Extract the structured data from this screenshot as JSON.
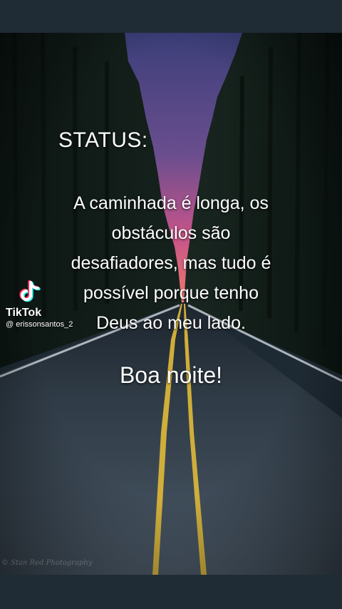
{
  "status": {
    "heading": "STATUS:"
  },
  "quote": {
    "lines": [
      "A caminhada é longa, os",
      "obstáculos são",
      "desafiadores, mas tudo é",
      "possível porque tenho",
      "Deus ao meu lado."
    ]
  },
  "greeting": "Boa noite!",
  "tiktok": {
    "brand": "TikTok",
    "handle": "@ erissonsantos_2",
    "icon": "tiktok-note-icon"
  },
  "photo_credit": "© Stan Red Photography",
  "colors": {
    "frame": "#1f2b35",
    "sky_top": "#3a3d78",
    "sky_glow": "#e0507a",
    "road": "#3a4754",
    "center_line": "#d8b43a",
    "text": "#ffffff"
  }
}
